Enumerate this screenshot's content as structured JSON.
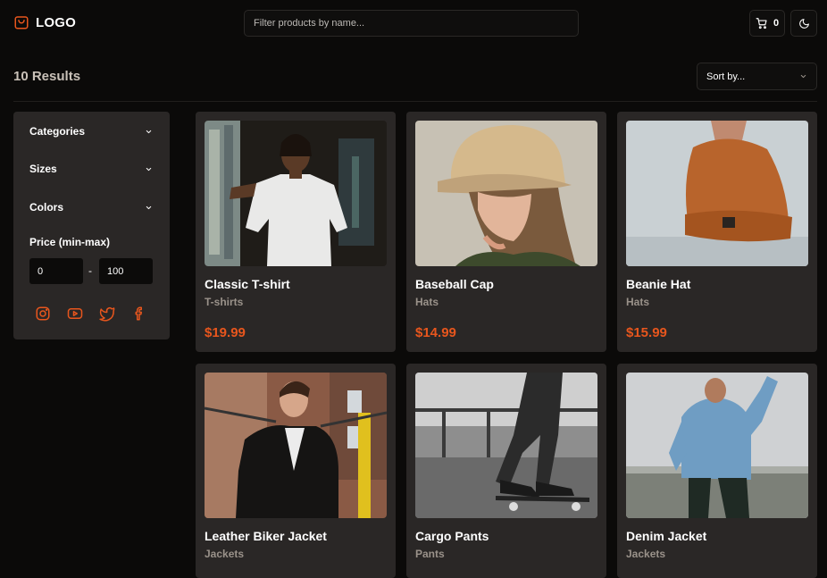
{
  "header": {
    "logo_text": "LOGO",
    "search_placeholder": "Filter products by name...",
    "cart_count": "0"
  },
  "results_label": "10 Results",
  "sort": {
    "label": "Sort by..."
  },
  "sidebar": {
    "filters": [
      {
        "label": "Categories"
      },
      {
        "label": "Sizes"
      },
      {
        "label": "Colors"
      }
    ],
    "price_label": "Price (min-max)",
    "price_min": "0",
    "price_separator": "-",
    "price_max": "100",
    "social_icons": [
      "instagram-icon",
      "youtube-icon",
      "twitter-icon",
      "facebook-icon"
    ]
  },
  "products": [
    {
      "name": "Classic T-shirt",
      "category": "T-shirts",
      "price": "$19.99"
    },
    {
      "name": "Baseball Cap",
      "category": "Hats",
      "price": "$14.99"
    },
    {
      "name": "Beanie Hat",
      "category": "Hats",
      "price": "$15.99"
    },
    {
      "name": "Leather Biker Jacket",
      "category": "Jackets",
      "price": ""
    },
    {
      "name": "Cargo Pants",
      "category": "Pants",
      "price": ""
    },
    {
      "name": "Denim Jacket",
      "category": "Jackets",
      "price": ""
    }
  ],
  "colors": {
    "accent": "#e8561d",
    "card_bg": "#2a2726",
    "page_bg": "#0b0a09"
  }
}
